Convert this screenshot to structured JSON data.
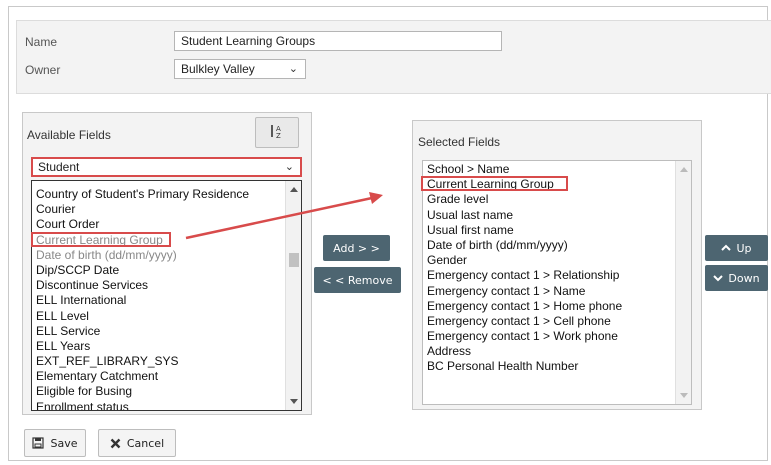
{
  "form": {
    "name_label": "Name",
    "name_value": "Student Learning Groups",
    "owner_label": "Owner",
    "owner_value": "Bulkley Valley"
  },
  "available": {
    "title": "Available Fields",
    "table_value": "Student",
    "items": [
      "Country of Student's Primary Residence",
      "Courier",
      "Court Order",
      "Current Learning Group",
      "Date of birth (dd/mm/yyyy)",
      "Dip/SCCP Date",
      "Discontinue Services",
      "ELL International",
      "ELL Level",
      "ELL Service",
      "ELL Years",
      "EXT_REF_LIBRARY_SYS",
      "Elementary Catchment",
      "Eligible for Busing",
      "Enrollment status"
    ]
  },
  "selected": {
    "title": "Selected Fields",
    "items": [
      "School > Name",
      "Current Learning Group",
      "Grade level",
      "Usual last name",
      "Usual first name",
      "Date of birth (dd/mm/yyyy)",
      "Gender",
      "Emergency contact 1 > Relationship",
      "Emergency contact 1 > Name",
      "Emergency contact 1 > Home phone",
      "Emergency contact 1 > Cell phone",
      "Emergency contact 1 > Work phone",
      "Address",
      "BC Personal Health Number"
    ]
  },
  "buttons": {
    "add": "Add > >",
    "remove": "< < Remove",
    "up": "Up",
    "down": "Down",
    "save": "Save",
    "cancel": "Cancel"
  },
  "colors": {
    "highlight": "#d84b4b",
    "action_button": "#4d6571"
  },
  "icons": [
    "sort-az-icon",
    "chevron-up-icon",
    "chevron-down-icon",
    "save-icon",
    "cancel-x-icon"
  ]
}
